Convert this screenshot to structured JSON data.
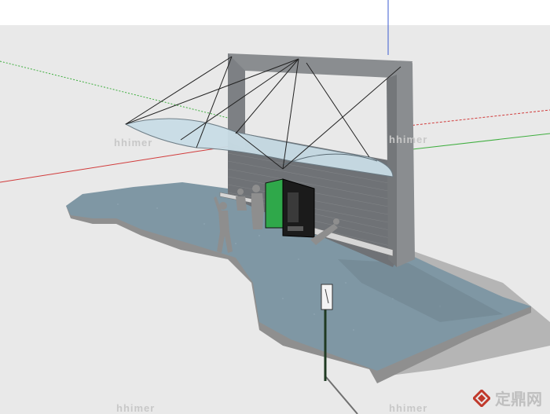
{
  "scene": {
    "description_label": "",
    "sky_color": "#ffffff",
    "ground_color": "#e9e9e9",
    "paving_color": "#7f97a4",
    "paving_edge_color": "#8f8f8f",
    "wall_color": "#6f7276",
    "frame_color": "#8a8d90",
    "canopy_color": "#c9dde6",
    "vending_machine_color": "#1b1b1b",
    "vending_accent_color": "#2fa84a",
    "figure_color": "#8e8e8e",
    "axis_red": "#d13b3b",
    "axis_green": "#3fae3f",
    "axis_blue": "#3b5bd1"
  },
  "watermarks": {
    "left": "hhimer",
    "center": "hhimer",
    "bottom_left": "hhimer",
    "bottom_right": "hhimer"
  },
  "logo": {
    "text": "定鼎网",
    "icon": "diamond-logo-icon"
  }
}
